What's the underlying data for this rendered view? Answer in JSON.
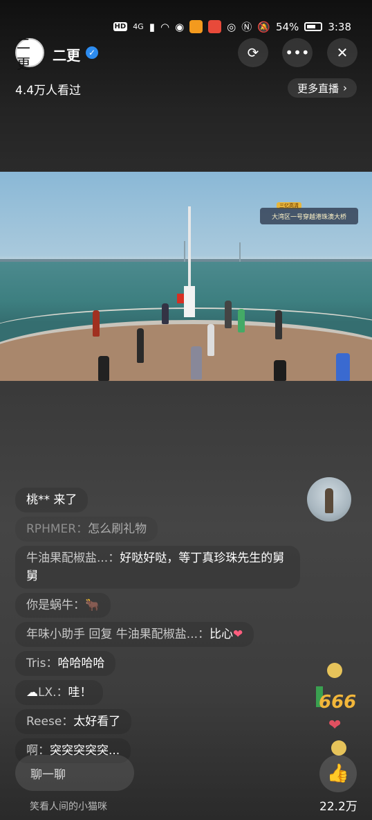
{
  "status_bar": {
    "hd_badge": "HD",
    "network": "4G",
    "battery": "54%",
    "time": "3:38"
  },
  "header": {
    "avatar_glyph": "二更",
    "host_name": "二更",
    "viewers": "4.4万人看过",
    "more_live": "更多直播"
  },
  "video": {
    "caption_tag": "三亿高清",
    "caption": "大湾区一号穿越港珠澳大桥"
  },
  "comments": [
    {
      "user": "",
      "text": "桃** 来了",
      "faded": false
    },
    {
      "user": "RPHMER：",
      "text": "怎么刷礼物",
      "faded": true
    },
    {
      "user": "牛油果配椒盐...：",
      "text": "好哒好哒，等丁真珍珠先生的舅舅",
      "faded": false
    },
    {
      "user": "你是蜗牛：",
      "text": "🐂",
      "faded": false
    },
    {
      "user": "年味小助手 回复 牛油果配椒盐...：",
      "text": "比心",
      "faded": false,
      "heart": "❤"
    },
    {
      "user": "Tris：",
      "text": "哈哈哈哈",
      "faded": false
    },
    {
      "user": "LX.：",
      "text": "哇！",
      "faded": false
    },
    {
      "user": "Reese：",
      "text": "太好看了",
      "faded": false
    },
    {
      "user": "啊：",
      "text": "突突突突突...",
      "faded": false
    }
  ],
  "floaters": {
    "text_666": "666"
  },
  "bottom": {
    "chat_placeholder": "聊一聊",
    "sub_caption": "笑看人间的小猫咪",
    "like_count": "22.2万"
  },
  "colors": {
    "verify_blue": "#2d8cf0",
    "heart_pink": "#ff5e7e"
  }
}
